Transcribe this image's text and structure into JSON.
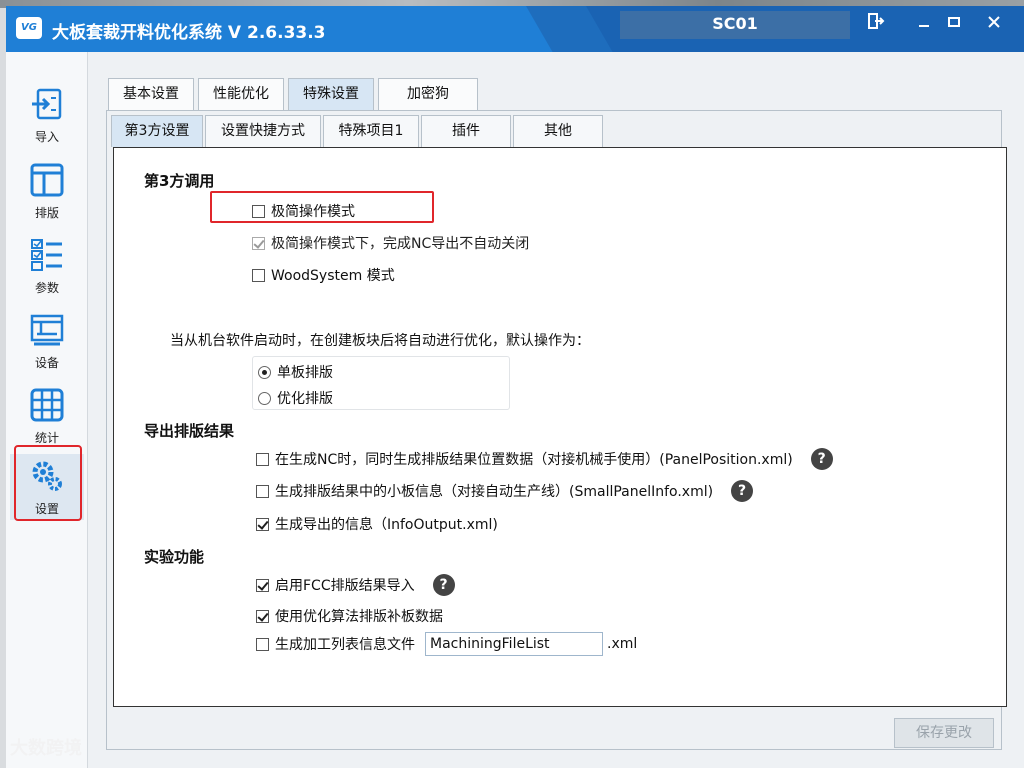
{
  "app": {
    "logo_text": "VG",
    "title": "大板套裁开料优化系统  V 2.6.33.3",
    "device": "SC01"
  },
  "window_controls": {
    "exit_icon": "exit-icon",
    "minimize_icon": "minimize-icon",
    "maximize_icon": "maximize-icon",
    "close_icon": "close-icon"
  },
  "sidebar": {
    "items": [
      {
        "label": "导入",
        "icon": "import-icon"
      },
      {
        "label": "排版",
        "icon": "layout-icon"
      },
      {
        "label": "参数",
        "icon": "parameters-icon"
      },
      {
        "label": "设备",
        "icon": "device-icon"
      },
      {
        "label": "统计",
        "icon": "statistics-icon"
      },
      {
        "label": "设置",
        "icon": "settings-icon"
      }
    ]
  },
  "tabs_top": [
    "基本设置",
    "性能优化",
    "特殊设置",
    "加密狗"
  ],
  "tabs_sub": [
    "第3方设置",
    "设置快捷方式",
    "特殊项目1",
    "插件",
    "其他"
  ],
  "sections": {
    "third_party": {
      "title": "第3方调用",
      "opt1": "极简操作模式",
      "opt2": "极简操作模式下，完成NC导出不自动关闭",
      "opt3": "WoodSystem 模式"
    },
    "startup": {
      "desc": "当从机台软件启动时，在创建板块后将自动进行优化，默认操作为：",
      "radio1": "单板排版",
      "radio2": "优化排版"
    },
    "export": {
      "title": "导出排版结果",
      "opt1": "在生成NC时，同时生成排版结果位置数据（对接机械手使用）(PanelPosition.xml)",
      "opt2": "生成排版结果中的小板信息（对接自动生产线）(SmallPanelInfo.xml)",
      "opt3": "生成导出的信息（InfoOutput.xml)"
    },
    "experimental": {
      "title": "实验功能",
      "opt1": "启用FCC排版结果导入",
      "opt2": "使用优化算法排版补板数据",
      "opt3": "生成加工列表信息文件",
      "filename": "MachiningFileList",
      "ext": ".xml"
    }
  },
  "help_glyph": "?",
  "save_label": "保存更改",
  "watermark": "大数跨境"
}
